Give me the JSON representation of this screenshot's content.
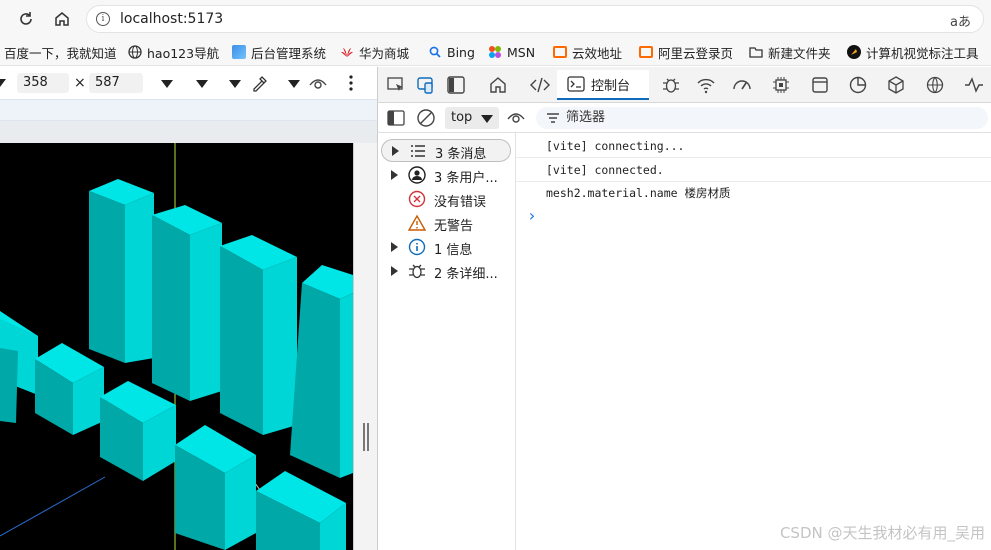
{
  "browser": {
    "url": "localhost:5173",
    "read_aloud": "aあ"
  },
  "bookmarks": [
    {
      "label": "百度一下，我就知道",
      "icon": "baidu-icon"
    },
    {
      "label": "hao123导航",
      "icon": "globe-icon"
    },
    {
      "label": "后台管理系统",
      "icon": "app-icon"
    },
    {
      "label": "华为商城",
      "icon": "huawei-icon"
    },
    {
      "label": "Bing",
      "icon": "bing-search-icon"
    },
    {
      "label": "MSN",
      "icon": "msn-icon"
    },
    {
      "label": "云效地址",
      "icon": "aliyun-icon"
    },
    {
      "label": "阿里云登录页",
      "icon": "aliyun-icon"
    },
    {
      "label": "新建文件夹",
      "icon": "folder-icon"
    },
    {
      "label": "计算机视觉标注工具",
      "icon": "cv-tool-icon"
    }
  ],
  "device_toolbar": {
    "width": "358",
    "times": "×",
    "height": "587"
  },
  "devtools": {
    "console_tab": "控制台",
    "context": "top",
    "filter_placeholder": "筛选器",
    "sidebar": [
      {
        "label": "3 条消息",
        "icon": "list-icon",
        "expandable": true
      },
      {
        "label": "3 条用户...",
        "icon": "user-icon",
        "expandable": true
      },
      {
        "label": "没有错误",
        "icon": "error-icon",
        "expandable": false
      },
      {
        "label": "无警告",
        "icon": "warning-icon",
        "expandable": false
      },
      {
        "label": "1 信息",
        "icon": "info-icon",
        "expandable": true
      },
      {
        "label": "2 条详细...",
        "icon": "bug-icon",
        "expandable": true
      }
    ],
    "logs": [
      "[vite] connecting...",
      "[vite] connected.",
      "mesh2.material.name 楼房材质"
    ],
    "prompt": "›"
  },
  "watermark": "CSDN @天生我材必有用_吴用",
  "colors": {
    "building": "#00d0d0",
    "accent": "#0f6cbd"
  }
}
